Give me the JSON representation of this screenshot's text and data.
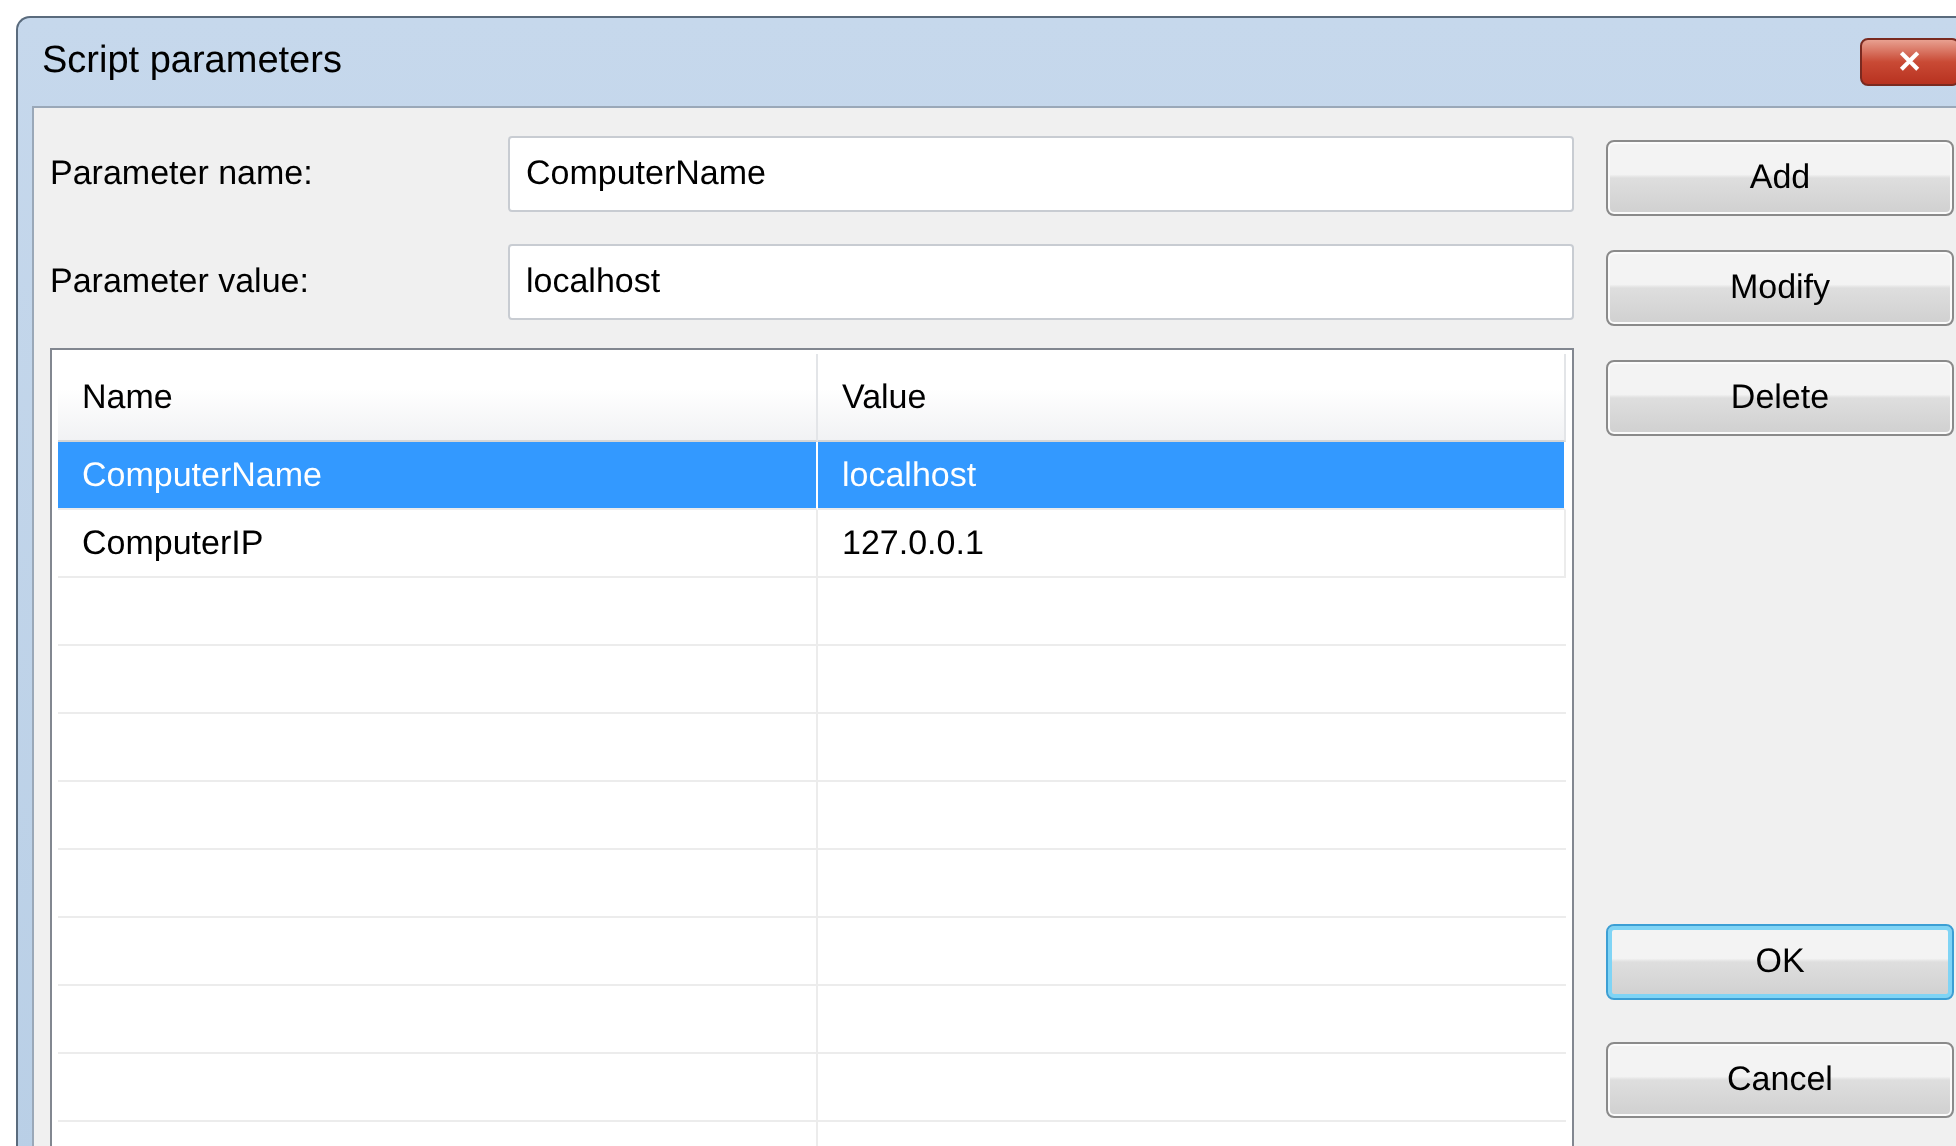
{
  "window": {
    "title": "Script parameters",
    "close": "✕"
  },
  "fields": [
    {
      "label": "Parameter name:",
      "value": "ComputerName"
    },
    {
      "label": "Parameter value:",
      "value": "localhost"
    }
  ],
  "table": {
    "columns": [
      "Name",
      "Value"
    ],
    "rows": [
      {
        "cells": [
          "ComputerName",
          "localhost"
        ],
        "selected": true
      },
      {
        "cells": [
          "ComputerIP",
          "127.0.0.1"
        ],
        "selected": false
      }
    ]
  },
  "buttons": [
    {
      "label": "Add",
      "focused": false,
      "kind": "edit"
    },
    {
      "label": "Modify",
      "focused": false,
      "kind": "edit"
    },
    {
      "label": "Delete",
      "focused": false,
      "kind": "edit"
    },
    {
      "label": "OK",
      "focused": true,
      "kind": "confirm"
    },
    {
      "label": "Cancel",
      "focused": false,
      "kind": "confirm"
    }
  ]
}
